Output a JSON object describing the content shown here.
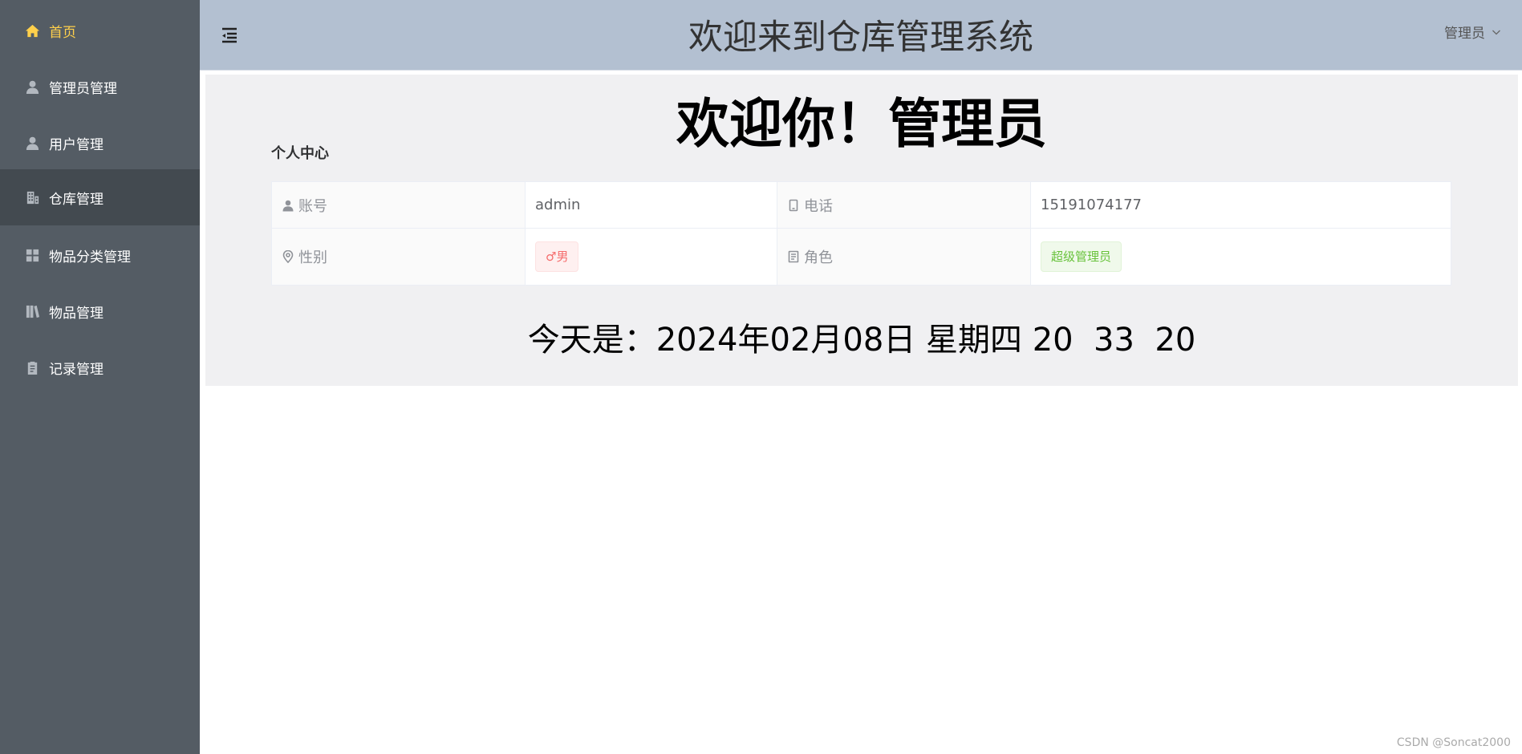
{
  "sidebar": {
    "items": [
      {
        "label": "首页",
        "icon": "home-icon"
      },
      {
        "label": "管理员管理",
        "icon": "user-icon"
      },
      {
        "label": "用户管理",
        "icon": "user-icon"
      },
      {
        "label": "仓库管理",
        "icon": "building-icon"
      },
      {
        "label": "物品分类管理",
        "icon": "grid-icon"
      },
      {
        "label": "物品管理",
        "icon": "collection-icon"
      },
      {
        "label": "记录管理",
        "icon": "clipboard-icon"
      }
    ],
    "active_color": "#ffd04b",
    "background": "#545c64"
  },
  "header": {
    "title": "欢迎来到仓库管理系统",
    "user_menu_label": "管理员",
    "background": "#b3c0d1"
  },
  "main": {
    "welcome": "欢迎你！管理员",
    "section_title": "个人中心",
    "profile": {
      "account_label": "账号",
      "account_value": "admin",
      "phone_label": "电话",
      "phone_value": "15191074177",
      "gender_label": "性别",
      "gender_value": "♂男",
      "role_label": "角色",
      "role_value": "超级管理员"
    },
    "today": "今天是：2024年02月08日 星期四 20  33  20"
  },
  "watermark": "CSDN @Soncat2000"
}
